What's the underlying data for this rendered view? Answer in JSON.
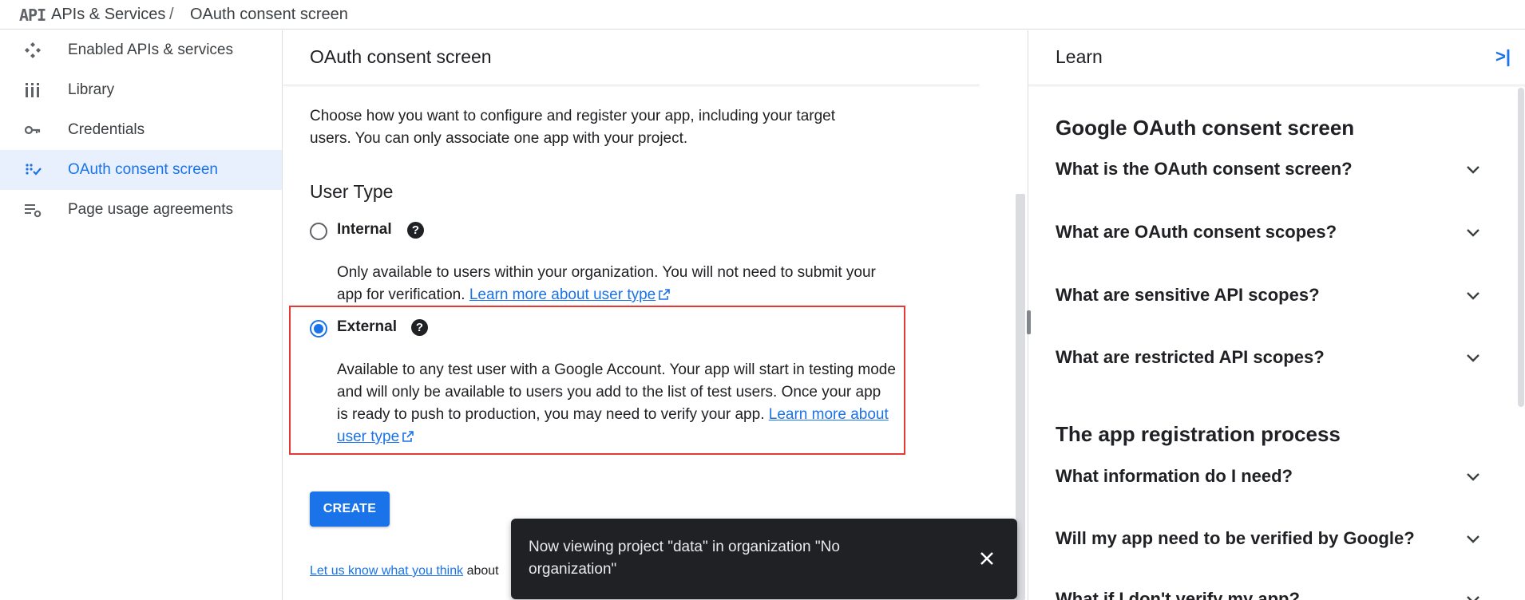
{
  "breadcrumb": {
    "logo_text": "API",
    "section": "APIs & Services",
    "separator": "/",
    "page": "OAuth consent screen"
  },
  "sidebar": {
    "items": [
      {
        "label": "Enabled APIs & services",
        "icon": "enabled-apis-icon"
      },
      {
        "label": "Library",
        "icon": "library-icon"
      },
      {
        "label": "Credentials",
        "icon": "key-icon"
      },
      {
        "label": "OAuth consent screen",
        "icon": "oauth-icon",
        "active": true
      },
      {
        "label": "Page usage agreements",
        "icon": "settings-list-icon"
      }
    ],
    "collapse_glyph": "<|"
  },
  "main": {
    "title": "OAuth consent screen",
    "intro": "Choose how you want to configure and register your app, including your target users. You can only associate one app with your project.",
    "user_type_heading": "User Type",
    "internal": {
      "label": "Internal",
      "selected": false,
      "desc": "Only available to users within your organization. You will not need to submit your app for verification.",
      "link": "Learn more about user type"
    },
    "external": {
      "label": "External",
      "selected": true,
      "desc": "Available to any test user with a Google Account. Your app will start in testing mode and will only be available to users you add to the list of test users. Once your app is ready to push to production, you may need to verify your app.",
      "link": "Learn more about user type"
    },
    "help_glyph": "?",
    "create_label": "CREATE",
    "feedback_link": "Let us know what you think",
    "feedback_tail": "about"
  },
  "snackbar": {
    "text": "Now viewing project \"data\" in organization \"No organization\""
  },
  "learn": {
    "title": "Learn",
    "close_glyph": ">|",
    "section1": "Google OAuth consent screen",
    "faq1": [
      "What is the OAuth consent screen?",
      "What are OAuth consent scopes?",
      "What are sensitive API scopes?",
      "What are restricted API scopes?"
    ],
    "section2": "The app registration process",
    "faq2": [
      "What information do I need?",
      "Will my app need to be verified by Google?",
      "What if I don't verify my app?"
    ]
  },
  "colors": {
    "accent": "#1a73e8",
    "highlight_border": "#e53935",
    "snackbar_bg": "#202124"
  }
}
